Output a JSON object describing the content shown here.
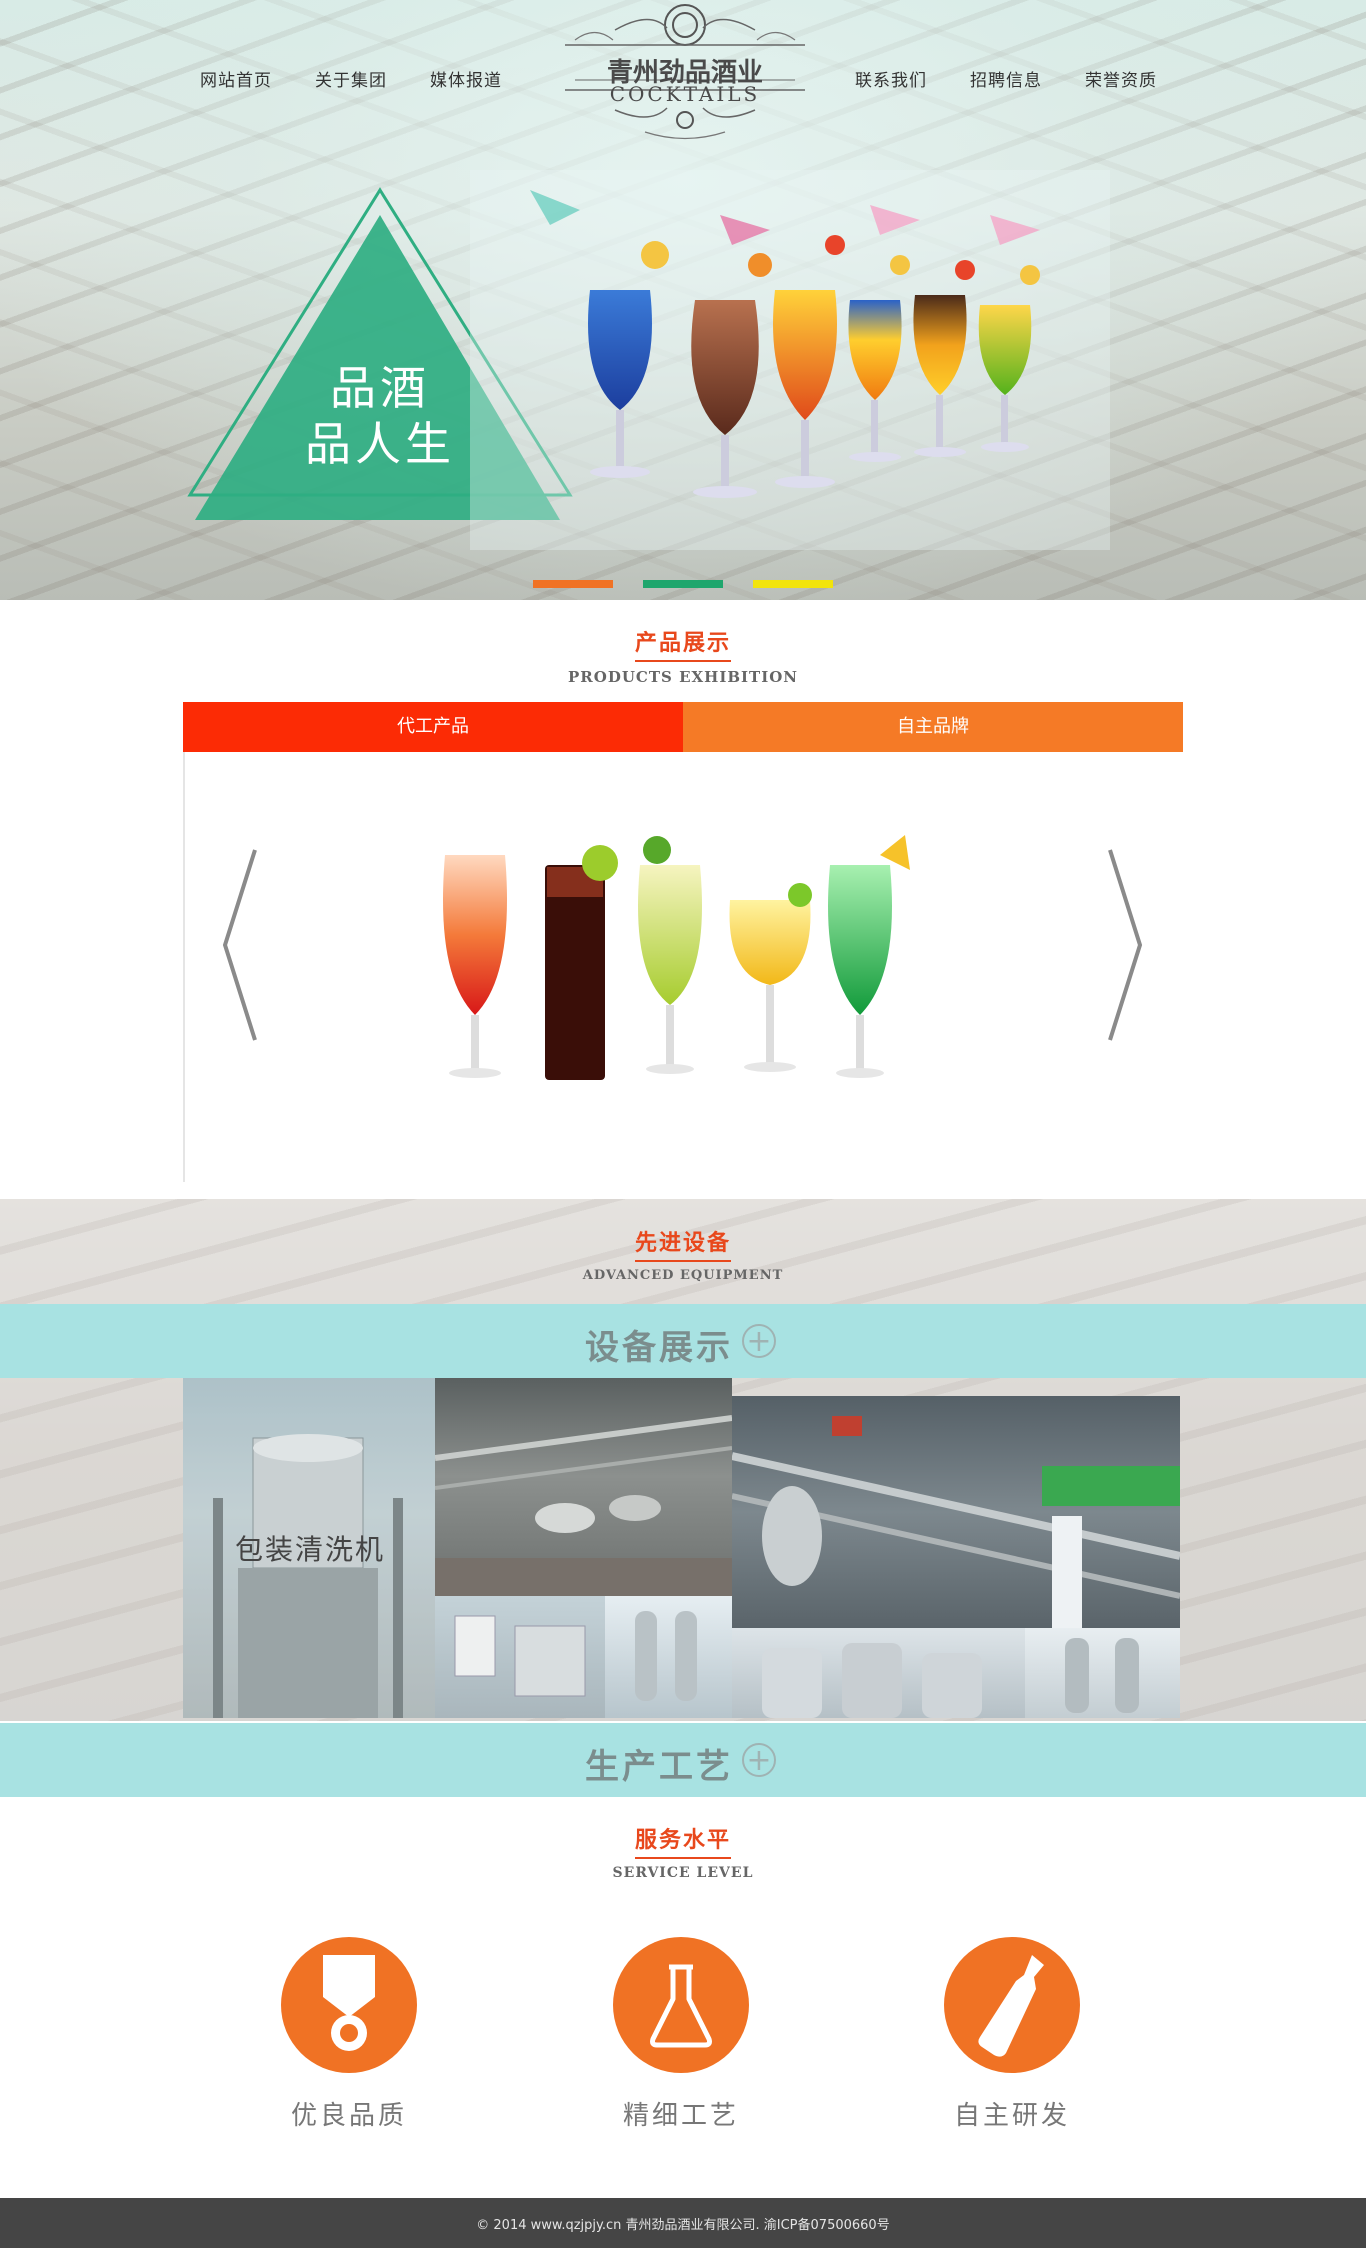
{
  "nav": {
    "left": [
      "网站首页",
      "关于集团",
      "媒体报道"
    ],
    "right": [
      "联系我们",
      "招聘信息",
      "荣誉资质"
    ]
  },
  "logo": {
    "title": "青州劲品酒业",
    "subtitle": "COCKTAILS"
  },
  "hero": {
    "slogan_line1": "品酒",
    "slogan_line2": "品人生",
    "triangle_color": "#2fae82",
    "dots": [
      {
        "color": "#f07224"
      },
      {
        "color": "#1fa66d"
      },
      {
        "color": "#f2e40c"
      }
    ]
  },
  "products": {
    "title_cn": "产品展示",
    "title_en": "PRODUCTS EXHIBITION",
    "tabs": [
      {
        "label": "代工产品",
        "color": "#fc2b05"
      },
      {
        "label": "自主品牌",
        "color": "#f57a26"
      }
    ],
    "prev_icon": "chevron-left-icon",
    "next_icon": "chevron-right-icon"
  },
  "equipment": {
    "title_cn": "先进设备",
    "title_en": "ADVANCED EQUIPMENT",
    "band1_label": "设备展示",
    "band2_label": "生产工艺",
    "photo_label": "包装清洗机",
    "band_color": "#a8e2e2"
  },
  "service": {
    "title_cn": "服务水平",
    "title_en": "SERVICE LEVEL",
    "items": [
      {
        "label": "优良品质",
        "icon": "medal-icon"
      },
      {
        "label": "精细工艺",
        "icon": "flask-icon"
      },
      {
        "label": "自主研发",
        "icon": "bottle-icon"
      }
    ],
    "accent": "#f07224"
  },
  "footer": {
    "text": "© 2014 www.qzjpjy.cn 青州劲品酒业有限公司. 渝ICP备07500660号"
  }
}
